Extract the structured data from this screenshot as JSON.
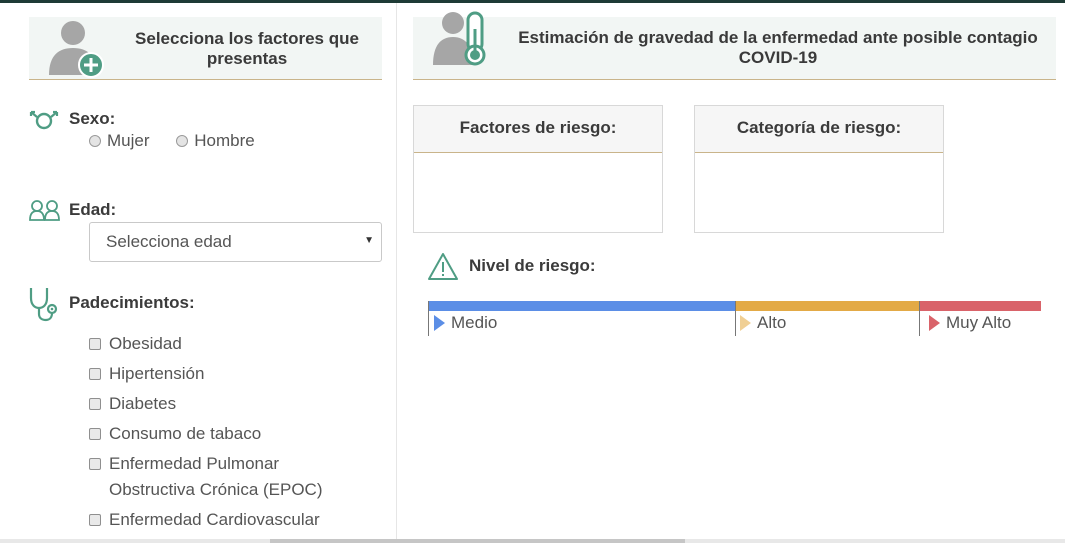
{
  "left_panel": {
    "title": "Selecciona los factores que presentas",
    "sexo": {
      "label": "Sexo:",
      "options": [
        "Mujer",
        "Hombre"
      ]
    },
    "edad": {
      "label": "Edad:",
      "placeholder": "Selecciona edad"
    },
    "padecimientos": {
      "label": "Padecimientos:",
      "items": [
        "Obesidad",
        "Hipertensión",
        "Diabetes",
        "Consumo de tabaco",
        "Enfermedad Pulmonar Obstructiva Crónica (EPOC)",
        "Enfermedad Cardiovascular"
      ]
    }
  },
  "right_panel": {
    "title": "Estimación de gravedad de la enfermedad ante posible contagio COVID-19",
    "factores_title": "Factores de riesgo:",
    "categoria_title": "Categoría de riesgo:",
    "nivel_label": "Nivel de riesgo:",
    "levels": [
      {
        "label": "Medio",
        "color": "#5b8ee6"
      },
      {
        "label": "Alto",
        "color": "#e3aa46"
      },
      {
        "label": "Muy Alto",
        "color": "#d9636a"
      }
    ]
  },
  "icons": {
    "left_header": "person-add-icon",
    "right_header": "person-thermometer-icon",
    "sexo": "gender-icon",
    "edad": "people-icon",
    "padecimientos": "stethoscope-icon",
    "nivel": "warning-icon"
  },
  "colors": {
    "accent_green": "#4f9d84",
    "header_bg": "#f2f6f4",
    "divider": "#c9b48a"
  }
}
